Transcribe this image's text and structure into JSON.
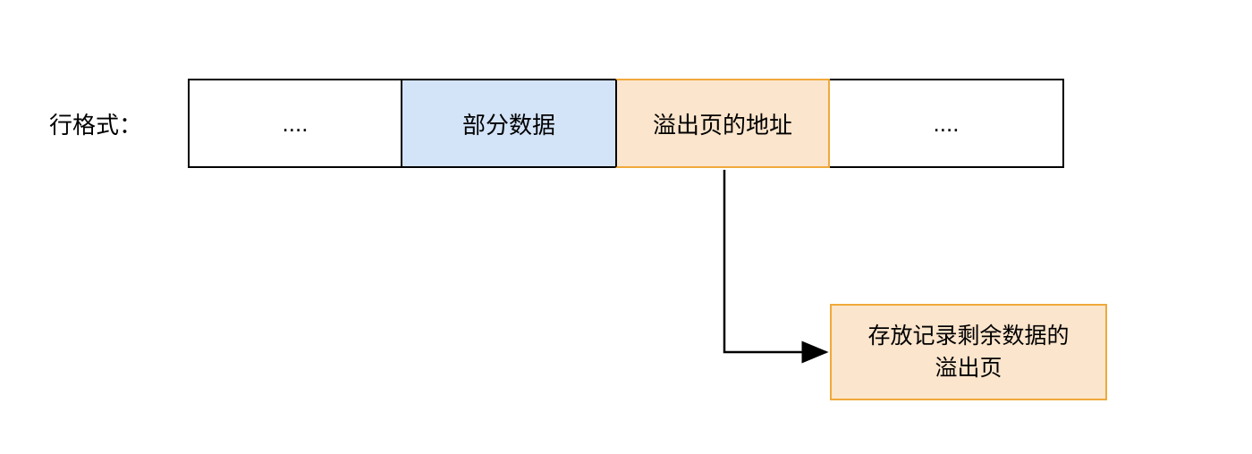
{
  "title": "行格式：",
  "row": {
    "cell_left": "....",
    "cell_partial_data": "部分数据",
    "cell_overflow_addr": "溢出页的地址",
    "cell_right": "...."
  },
  "overflow_page": {
    "line1": "存放记录剩余数据的",
    "line2": "溢出页"
  },
  "colors": {
    "blue_fill": "#d3e3f8",
    "orange_fill": "#fbe5cc",
    "orange_border": "#f0a93a",
    "black": "#000000"
  }
}
